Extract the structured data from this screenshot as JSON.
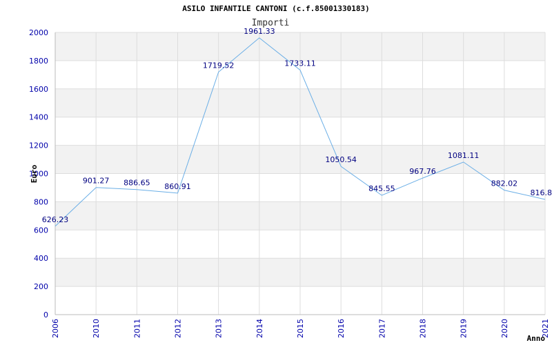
{
  "chart_data": {
    "type": "line",
    "title": "ASILO INFANTILE CANTONI (c.f.85001330183)",
    "subtitle": "Importi",
    "xlabel": "Anno",
    "ylabel": "Euro",
    "categories": [
      "2006",
      "2010",
      "2011",
      "2012",
      "2013",
      "2014",
      "2015",
      "2016",
      "2017",
      "2018",
      "2019",
      "2020",
      "2021"
    ],
    "series": [
      {
        "values": [
          626.23,
          901.27,
          886.65,
          860.91,
          1719.52,
          1961.33,
          1733.11,
          1050.54,
          845.55,
          967.76,
          1081.11,
          882.02,
          816.8
        ],
        "labels": [
          "626.23",
          "901.27",
          "886.65",
          "860.91",
          "1719.52",
          "1961.33",
          "1733.11",
          "1050.54",
          "845.55",
          "967.76",
          "1081.11",
          "882.02",
          "816.8"
        ]
      }
    ],
    "ylim": [
      0,
      2000
    ],
    "yticks": [
      "0",
      "200",
      "400",
      "600",
      "800",
      "1000",
      "1200",
      "1400",
      "1600",
      "1800",
      "2000"
    ],
    "grid": true,
    "colors": {
      "line": "#6aaee6",
      "band": "#f2f2f2",
      "grid": "#dddddd",
      "tick": "#0000aa",
      "label": "#000080"
    }
  }
}
